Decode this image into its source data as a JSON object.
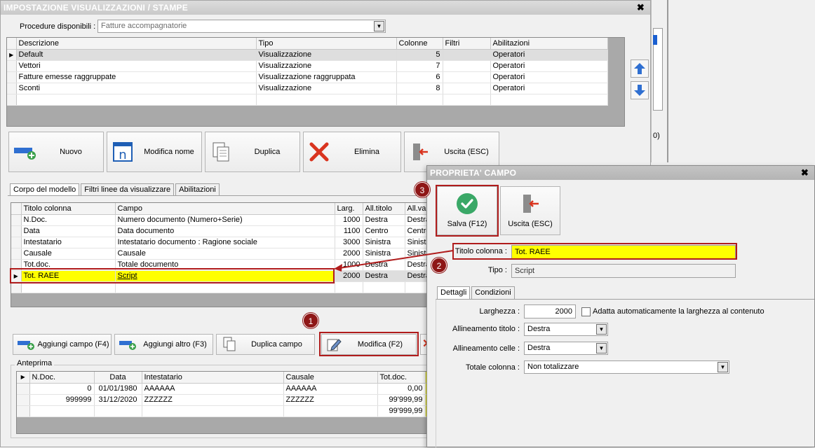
{
  "main_window": {
    "title": "IMPOSTAZIONE VISUALIZZAZIONI / STAMPE",
    "procedure_label": "Procedure disponibili :",
    "procedure_value": "Fatture accompagnatorie",
    "views_table": {
      "columns": [
        "Descrizione",
        "Tipo",
        "Colonne",
        "Filtri",
        "Abilitazioni"
      ],
      "rows": [
        {
          "descrizione": "Default",
          "tipo": "Visualizzazione",
          "colonne": "5",
          "filtri": "",
          "abilitazioni": "Operatori"
        },
        {
          "descrizione": "Vettori",
          "tipo": "Visualizzazione",
          "colonne": "7",
          "filtri": "",
          "abilitazioni": "Operatori"
        },
        {
          "descrizione": "Fatture emesse raggruppate",
          "tipo": "Visualizzazione raggruppata",
          "colonne": "6",
          "filtri": "",
          "abilitazioni": "Operatori"
        },
        {
          "descrizione": "Sconti",
          "tipo": "Visualizzazione",
          "colonne": "8",
          "filtri": "",
          "abilitazioni": "Operatori"
        }
      ]
    },
    "buttons": {
      "nuovo": "Nuovo",
      "modifica_nome": "Modifica nome",
      "duplica": "Duplica",
      "elimina": "Elimina",
      "uscita": "Uscita (ESC)"
    },
    "tabs": [
      "Corpo del modello",
      "Filtri linee da visualizzare",
      "Abilitazioni"
    ],
    "fields_table": {
      "columns": [
        "Titolo colonna",
        "Campo",
        "Larg.",
        "All.titolo",
        "All.val"
      ],
      "rows": [
        {
          "titolo": "N.Doc.",
          "campo": "Numero documento (Numero+Serie)",
          "larg": "1000",
          "all_titolo": "Destra",
          "all_val": "Destra"
        },
        {
          "titolo": "Data",
          "campo": "Data documento",
          "larg": "1100",
          "all_titolo": "Centro",
          "all_val": "Centro"
        },
        {
          "titolo": "Intestatario",
          "campo": "Intestatario documento : Ragione sociale",
          "larg": "3000",
          "all_titolo": "Sinistra",
          "all_val": "Sinistr"
        },
        {
          "titolo": "Causale",
          "campo": "Causale",
          "larg": "2000",
          "all_titolo": "Sinistra",
          "all_val": "Sinistr"
        },
        {
          "titolo": "Tot.doc.",
          "campo": "Totale documento",
          "larg": "1000",
          "all_titolo": "Destra",
          "all_val": "Destra"
        },
        {
          "titolo": "Tot. RAEE",
          "campo": "Script",
          "larg": "2000",
          "all_titolo": "Destra",
          "all_val": "Destra"
        }
      ]
    },
    "field_buttons": {
      "aggiungi_campo": "Aggiungi campo (F4)",
      "aggiungi_altro": "Aggiungi altro (F3)",
      "duplica_campo": "Duplica campo",
      "modifica": "Modifica (F2)"
    },
    "preview": {
      "label": "Anteprima",
      "columns": [
        "N.Doc.",
        "Data",
        "Intestatario",
        "Causale",
        "Tot.doc."
      ],
      "rows": [
        {
          "ndoc": "0",
          "data": "01/01/1980",
          "intestatario": "AAAAAA",
          "causale": "AAAAAA",
          "totdoc": "0,00"
        },
        {
          "ndoc": "999999",
          "data": "31/12/2020",
          "intestatario": "ZZZZZZ",
          "causale": "ZZZZZZ",
          "totdoc": "99'999,99"
        },
        {
          "ndoc": "",
          "data": "",
          "intestatario": "",
          "causale": "",
          "totdoc": "99'999,99"
        }
      ]
    }
  },
  "props_window": {
    "title": "PROPRIETA' CAMPO",
    "salva": "Salva (F12)",
    "uscita": "Uscita (ESC)",
    "titolo_colonna_label": "Titolo colonna :",
    "titolo_colonna_value": "Tot. RAEE",
    "tipo_label": "Tipo :",
    "tipo_value": "Script",
    "tabs": [
      "Dettagli",
      "Condizioni"
    ],
    "larghezza_label": "Larghezza :",
    "larghezza_value": "2000",
    "adatta_label": "Adatta automaticamente la larghezza al contenuto",
    "allineamento_titolo_label": "Allineamento titolo :",
    "allineamento_titolo_value": "Destra",
    "allineamento_celle_label": "Allineamento celle :",
    "allineamento_celle_value": "Destra",
    "totale_colonna_label": "Totale colonna :",
    "totale_colonna_value": "Non totalizzare"
  },
  "background_fragment": "0)",
  "callouts": [
    "1",
    "2",
    "3"
  ],
  "colors": {
    "highlight": "#ffff00",
    "callout": "#8e1616",
    "accent_red": "#b01c1c"
  }
}
